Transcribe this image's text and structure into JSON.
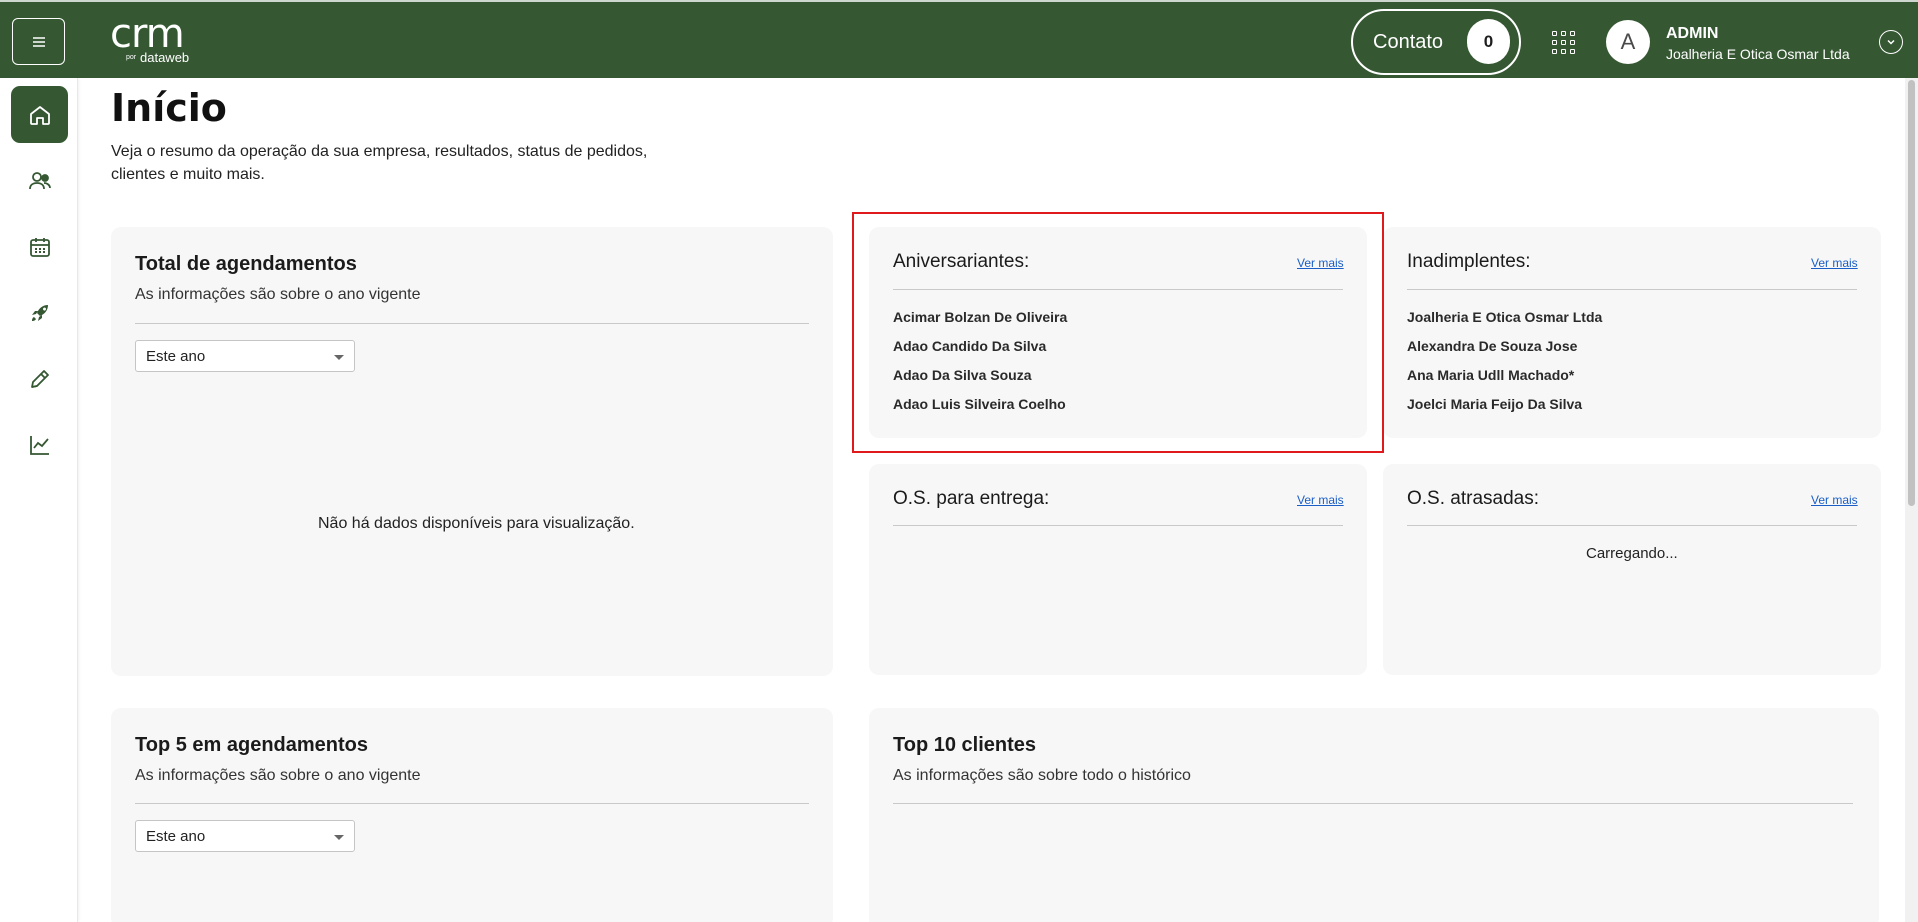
{
  "header": {
    "logo_main": "crm",
    "logo_por": "por",
    "logo_sub": "dataweb",
    "contato_label": "Contato",
    "contato_count": "0",
    "avatar_initial": "A",
    "user_name": "ADMIN",
    "user_company": "Joalheria E Otica Osmar Ltda"
  },
  "sidebar": {
    "items": [
      {
        "icon": "home-icon"
      },
      {
        "icon": "users-icon"
      },
      {
        "icon": "calendar-icon"
      },
      {
        "icon": "rocket-icon"
      },
      {
        "icon": "pencil-icon"
      },
      {
        "icon": "chart-line-icon"
      }
    ]
  },
  "page": {
    "title": "Início",
    "subtitle": "Veja o resumo da operação da sua empresa, resultados, status de pedidos, clientes e muito mais."
  },
  "total_agendamentos": {
    "title": "Total de agendamentos",
    "subtitle": "As informações são sobre o ano vigente",
    "select_value": "Este ano",
    "empty": "Não há dados disponíveis para visualização."
  },
  "aniversariantes": {
    "title": "Aniversariantes:",
    "ver_mais": "Ver mais",
    "items": [
      "Acimar Bolzan De Oliveira",
      "Adao Candido Da Silva",
      "Adao Da Silva Souza",
      "Adao Luis Silveira Coelho"
    ]
  },
  "inadimplentes": {
    "title": "Inadimplentes:",
    "ver_mais": "Ver mais",
    "items": [
      "Joalheria E Otica Osmar Ltda",
      "Alexandra De Souza Jose",
      "Ana Maria Udll Machado*",
      "Joelci Maria Feijo Da Silva"
    ]
  },
  "os_entrega": {
    "title": "O.S. para entrega:",
    "ver_mais": "Ver mais"
  },
  "os_atrasadas": {
    "title": "O.S. atrasadas:",
    "ver_mais": "Ver mais",
    "status": "Carregando..."
  },
  "top5": {
    "title": "Top 5 em agendamentos",
    "subtitle": "As informações são sobre o ano vigente",
    "select_value": "Este ano"
  },
  "top10": {
    "title": "Top 10 clientes",
    "subtitle": "As informações são sobre todo o histórico"
  },
  "colors": {
    "brand": "#355833",
    "highlight": "#e0191d",
    "link": "#1a5ec7"
  }
}
